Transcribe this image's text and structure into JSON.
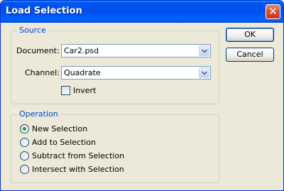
{
  "window": {
    "title": "Load Selection",
    "close_symbol": "✕"
  },
  "source": {
    "legend": "Source",
    "document_label": "Document:",
    "document_value": "Car2.psd",
    "channel_label": "Channel:",
    "channel_value": "Quadrate",
    "invert_label": "Invert",
    "invert_checked": false
  },
  "operation": {
    "legend": "Operation",
    "options": [
      {
        "label": "New Selection",
        "selected": true
      },
      {
        "label": "Add to Selection",
        "selected": false
      },
      {
        "label": "Subtract from Selection",
        "selected": false
      },
      {
        "label": "Intersect with Selection",
        "selected": false
      }
    ]
  },
  "buttons": {
    "ok": "OK",
    "cancel": "Cancel"
  },
  "colors": {
    "titlebar": "#0054e3",
    "accent_text": "#0046d5",
    "radio_dot": "#21a121",
    "close": "#d9532e"
  }
}
